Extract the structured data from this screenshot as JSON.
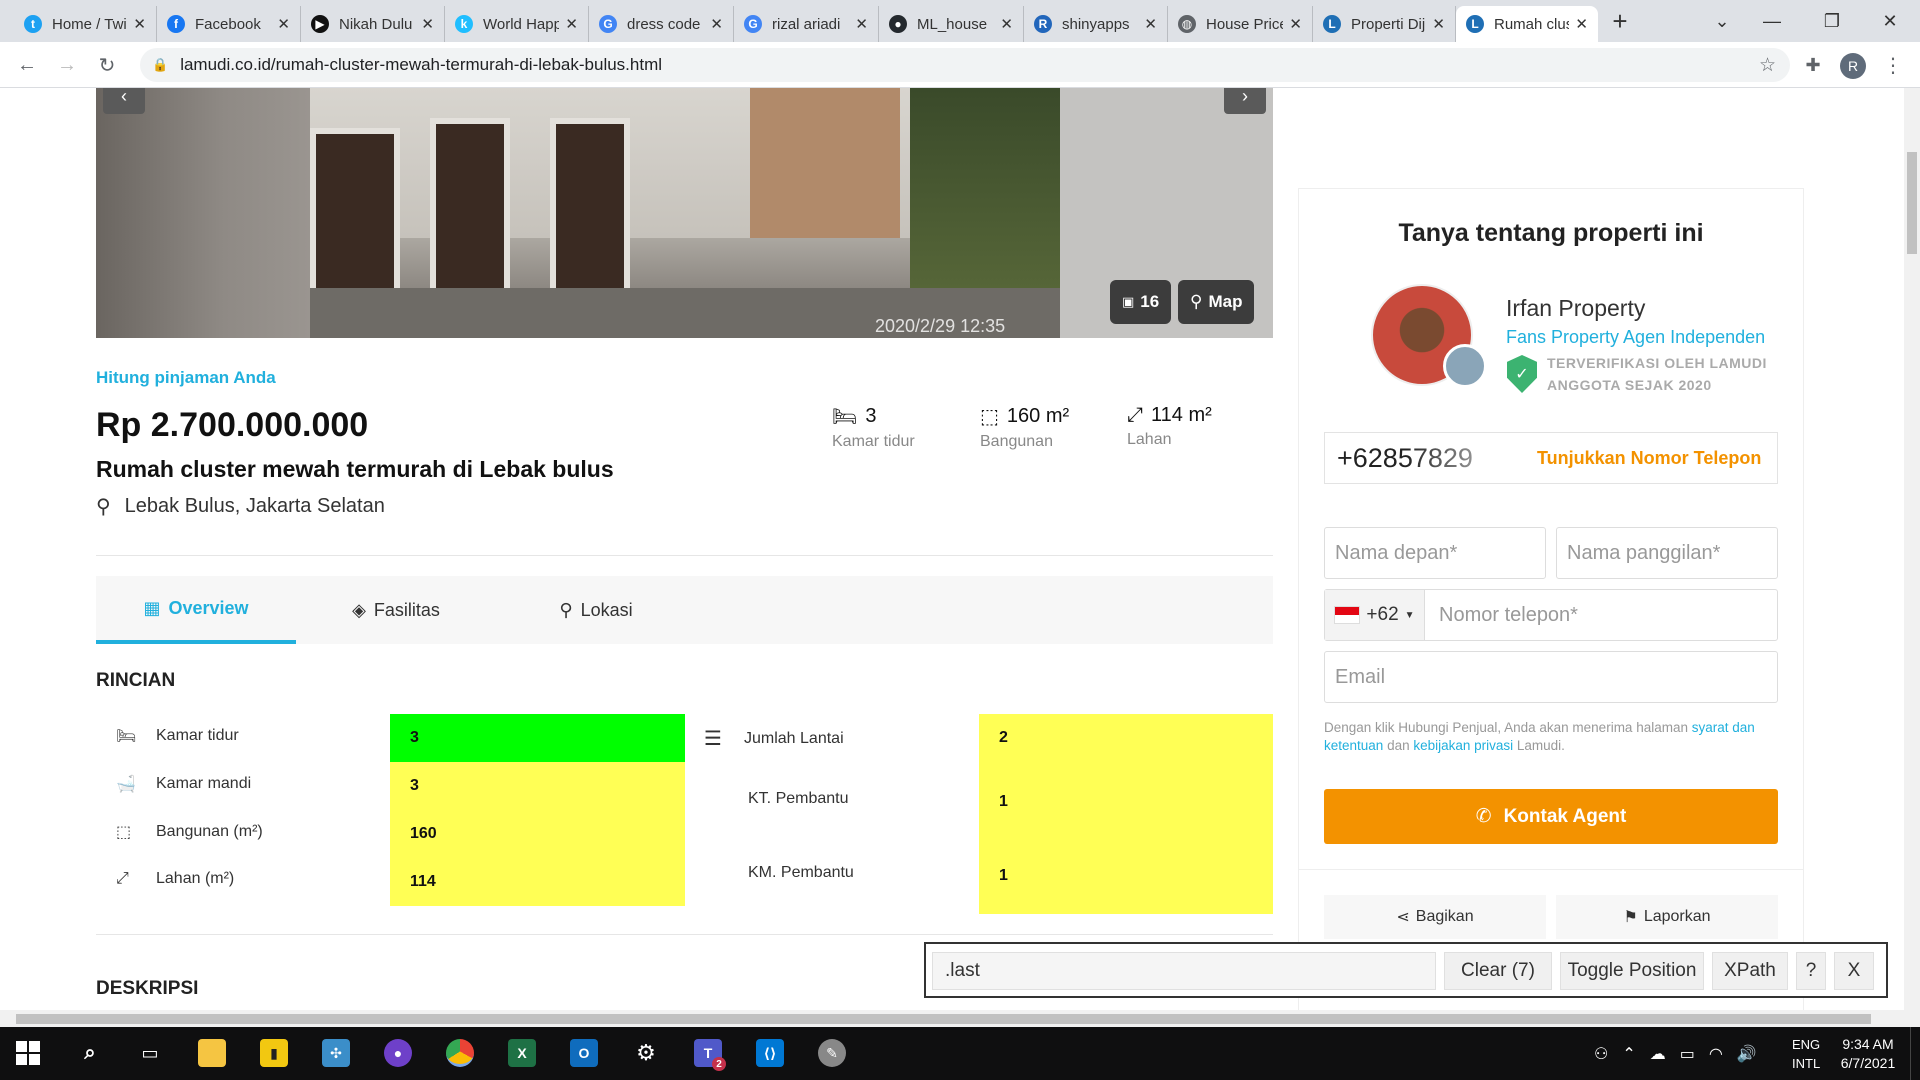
{
  "tabs": [
    {
      "label": "Home / Twitter",
      "icon": "twitter-icon",
      "color": "#1da1f2",
      "glyph": "t"
    },
    {
      "label": "Facebook",
      "icon": "facebook-icon",
      "color": "#1877f2",
      "glyph": "f"
    },
    {
      "label": "Nikah Dulu",
      "icon": "video-icon",
      "color": "#111111",
      "glyph": "▶"
    },
    {
      "label": "World Happiness",
      "icon": "kaggle-icon",
      "color": "#20beff",
      "glyph": "k"
    },
    {
      "label": "dress code",
      "icon": "google-icon",
      "color": "#4285f4",
      "glyph": "G"
    },
    {
      "label": "rizal ariadi",
      "icon": "google-icon",
      "color": "#4285f4",
      "glyph": "G"
    },
    {
      "label": "ML_house",
      "icon": "github-icon",
      "color": "#24292e",
      "glyph": "●"
    },
    {
      "label": "shinyapps",
      "icon": "r-icon",
      "color": "#2266bb",
      "glyph": "R"
    },
    {
      "label": "House Price",
      "icon": "globe-icon",
      "color": "#5f6368",
      "glyph": "◍"
    },
    {
      "label": "Properti Dijual",
      "icon": "lamudi-icon",
      "color": "#1f6fb5",
      "glyph": "L"
    },
    {
      "label": "Rumah cluster",
      "icon": "lamudi-icon",
      "color": "#1f6fb5",
      "glyph": "L"
    }
  ],
  "browser": {
    "url": "lamudi.co.id/rumah-cluster-mewah-termurah-di-lebak-bulus.html",
    "profile_initial": "R"
  },
  "gallery": {
    "photo_count": "16",
    "map_label": "Map",
    "timestamp": "2020/2/29 12:35"
  },
  "listing": {
    "loan_link": "Hitung pinjaman Anda",
    "price": "Rp 2.700.000.000",
    "title": "Rumah cluster mewah termurah di Lebak bulus",
    "location": "Lebak Bulus, Jakarta Selatan",
    "stats": [
      {
        "value": "3",
        "label": "Kamar tidur"
      },
      {
        "value": "160 m²",
        "label": "Bangunan"
      },
      {
        "value": "114 m²",
        "label": "Lahan"
      }
    ]
  },
  "section_tabs": [
    {
      "label": "Overview"
    },
    {
      "label": "Fasilitas"
    },
    {
      "label": "Lokasi"
    }
  ],
  "rincian": {
    "heading": "RINCIAN",
    "left": [
      {
        "label": "Kamar tidur",
        "value": "3"
      },
      {
        "label": "Kamar mandi",
        "value": "3"
      },
      {
        "label": "Bangunan (m²)",
        "value": "160"
      },
      {
        "label": "Lahan (m²)",
        "value": "114"
      }
    ],
    "right": [
      {
        "label": "Jumlah Lantai",
        "value": "2"
      },
      {
        "label": "KT. Pembantu",
        "value": "1"
      },
      {
        "label": "KM. Pembantu",
        "value": "1"
      }
    ],
    "highlight_green": "#00ff00",
    "highlight_yellow": "#ffff55"
  },
  "deskripsi_heading": "DESKRIPSI",
  "sidebar": {
    "heading": "Tanya tentang properti ini",
    "agent_name": "Irfan Property",
    "agency": "Fans Property Agen Independen",
    "verified": "TERVERIFIKASI OLEH LAMUDI",
    "member_since": "ANGGOTA SEJAK 2020",
    "phone_partial": "+62857829",
    "show_phone": "Tunjukkan Nomor Telepon",
    "first_name_ph": "Nama depan*",
    "nickname_ph": "Nama panggilan*",
    "country_code": "+62",
    "phone_ph": "Nomor telepon*",
    "email_ph": "Email",
    "disclaimer_pre": "Dengan klik Hubungi Penjual, Anda akan menerima halaman ",
    "disclaimer_link1": "syarat dan ketentuan",
    "disclaimer_mid": " dan ",
    "disclaimer_link2": "kebijakan privasi",
    "disclaimer_post": " Lamudi.",
    "contact_button": "Kontak Agent",
    "share": "Bagikan",
    "report": "Laporkan",
    "accent": "#f39200"
  },
  "xpath_tool": {
    "input_value": ".last",
    "clear": "Clear (7)",
    "toggle": "Toggle Position",
    "xpath": "XPath",
    "help": "?",
    "close": "X"
  },
  "taskbar": {
    "lang_top": "ENG",
    "lang_bottom": "INTL",
    "time": "9:34 AM",
    "date": "6/7/2021",
    "teams_badge": "2"
  }
}
